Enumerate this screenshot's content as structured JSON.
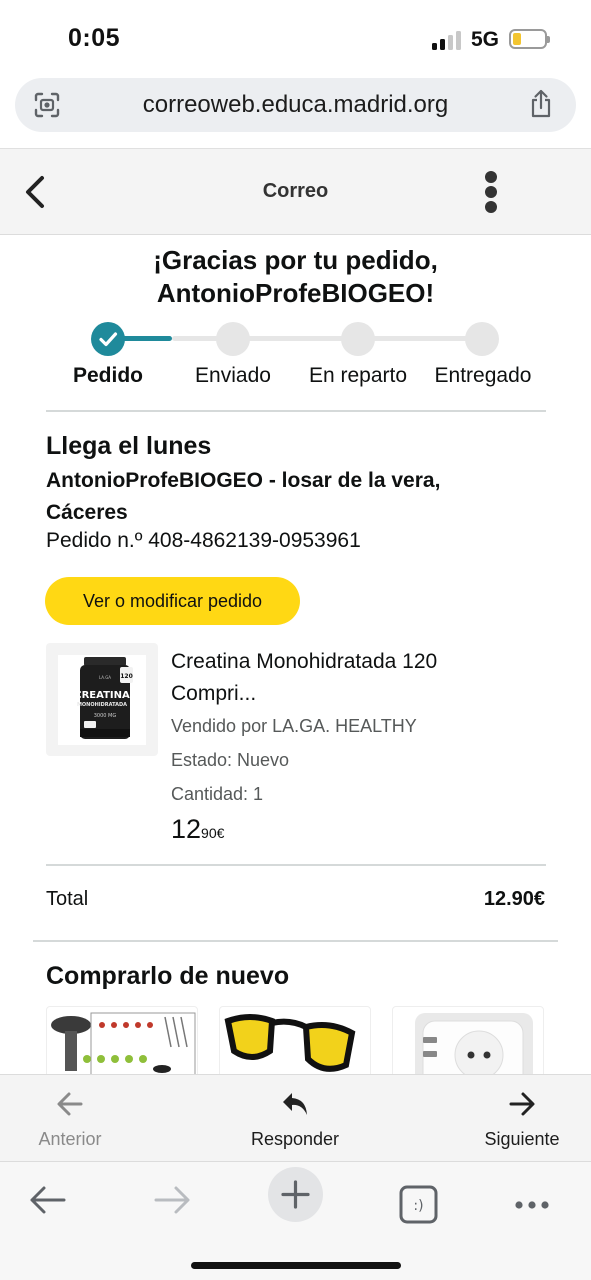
{
  "status_bar": {
    "time": "0:05",
    "network": "5G",
    "battery_color": "#f3c530"
  },
  "browser": {
    "url": "correoweb.educa.madrid.org"
  },
  "app_header": {
    "title": "Correo"
  },
  "email": {
    "thanks_line1": "¡Gracias por tu pedido,",
    "thanks_line2": "AntonioProfeBIOGEO!",
    "tracking": {
      "accent_color": "#1f8a9b",
      "steps": [
        {
          "label": "Pedido",
          "done": true
        },
        {
          "label": "Enviado",
          "done": false
        },
        {
          "label": "En reparto",
          "done": false
        },
        {
          "label": "Entregado",
          "done": false
        }
      ]
    },
    "arrival": "Llega el lunes",
    "address": "AntonioProfeBIOGEO - losar de la vera, Cáceres",
    "order_number": "Pedido n.º 408-4862139-0953961",
    "view_button": "Ver o modificar pedido",
    "button_color": "#ffd814",
    "product": {
      "name": "Creatina Monohidratada 120 Compri...",
      "seller": "Vendido por LA.GA. HEALTHY",
      "state": "Estado: Nuevo",
      "quantity": "Cantidad: 1",
      "price_whole": "12",
      "price_fraction": "90€",
      "image_text_line1": "CREATINA",
      "image_text_line2": "MONOHIDRATADA",
      "image_text_line3": "3000 MG",
      "image_badge": "120"
    },
    "total_label": "Total",
    "total_value": "12.90€",
    "buy_again_title": "Comprarlo de nuevo"
  },
  "mail_toolbar": {
    "previous": "Anterior",
    "reply": "Responder",
    "next": "Siguiente"
  },
  "browser_toolbar": {
    "tabs_icon_text": ":)"
  }
}
